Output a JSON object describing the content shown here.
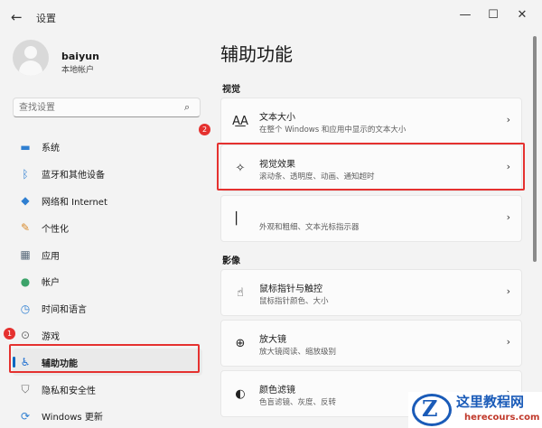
{
  "window": {
    "title": "设置",
    "back_icon": "back-arrow-icon",
    "min_glyph": "—",
    "max_glyph": "☐",
    "close_glyph": "✕"
  },
  "profile": {
    "name": "baiyun",
    "account_type": "本地帐户"
  },
  "search": {
    "placeholder": "查找设置"
  },
  "nav": [
    {
      "label": "系统",
      "icon": "monitor-icon",
      "glyph": "▬",
      "color": "#2f7fd1"
    },
    {
      "label": "蓝牙和其他设备",
      "icon": "bluetooth-icon",
      "glyph": "ᛒ",
      "color": "#2f7fd1"
    },
    {
      "label": "网络和 Internet",
      "icon": "wifi-icon",
      "glyph": "◆",
      "color": "#2f7fd1"
    },
    {
      "label": "个性化",
      "icon": "brush-icon",
      "glyph": "✎",
      "color": "#d98a2b"
    },
    {
      "label": "应用",
      "icon": "apps-icon",
      "glyph": "▦",
      "color": "#5a6b7b"
    },
    {
      "label": "帐户",
      "icon": "person-icon",
      "glyph": "●",
      "color": "#3ca36a"
    },
    {
      "label": "时间和语言",
      "icon": "globe-clock-icon",
      "glyph": "◷",
      "color": "#2f7fd1"
    },
    {
      "label": "游戏",
      "icon": "gamepad-icon",
      "glyph": "⊙",
      "color": "#6b6b6b"
    },
    {
      "label": "辅助功能",
      "icon": "accessibility-icon",
      "glyph": "♿",
      "color": "#1f6fd1",
      "active": true
    },
    {
      "label": "隐私和安全性",
      "icon": "shield-icon",
      "glyph": "⛉",
      "color": "#6b6b6b"
    },
    {
      "label": "Windows 更新",
      "icon": "update-icon",
      "glyph": "⟳",
      "color": "#2f7fd1"
    }
  ],
  "annotations": {
    "badge1": "1",
    "badge2": "2",
    "highlight_color": "#e5312f"
  },
  "main": {
    "title": "辅助功能",
    "sections": [
      {
        "label": "视觉"
      },
      {
        "label": "影像"
      }
    ],
    "cards": [
      {
        "title": "文本大小",
        "subtitle": "在整个 Windows 和应用中显示的文本大小",
        "icon": "text-size-icon",
        "glyph": "A͟A"
      },
      {
        "title": "视觉效果",
        "subtitle": "滚动条、透明度、动画、通知超时",
        "icon": "visual-effects-icon",
        "glyph": "✧"
      },
      {
        "title": "",
        "subtitle": "外观和粗细、文本光标指示器",
        "icon": "text-cursor-icon",
        "glyph": "▏"
      },
      {
        "title": "鼠标指针与触控",
        "subtitle": "鼠标指针颜色、大小",
        "icon": "mouse-pointer-icon",
        "glyph": "☝"
      },
      {
        "title": "放大镜",
        "subtitle": "放大镜阅读、缩放级别",
        "icon": "magnifier-icon",
        "glyph": "⊕"
      },
      {
        "title": "颜色滤镜",
        "subtitle": "色盲滤镜、灰度、反转",
        "icon": "palette-icon",
        "glyph": "◐"
      }
    ],
    "chevron": "›"
  },
  "watermark": {
    "title": "这里教程网",
    "url": "herecours.com",
    "letter": "Z"
  }
}
